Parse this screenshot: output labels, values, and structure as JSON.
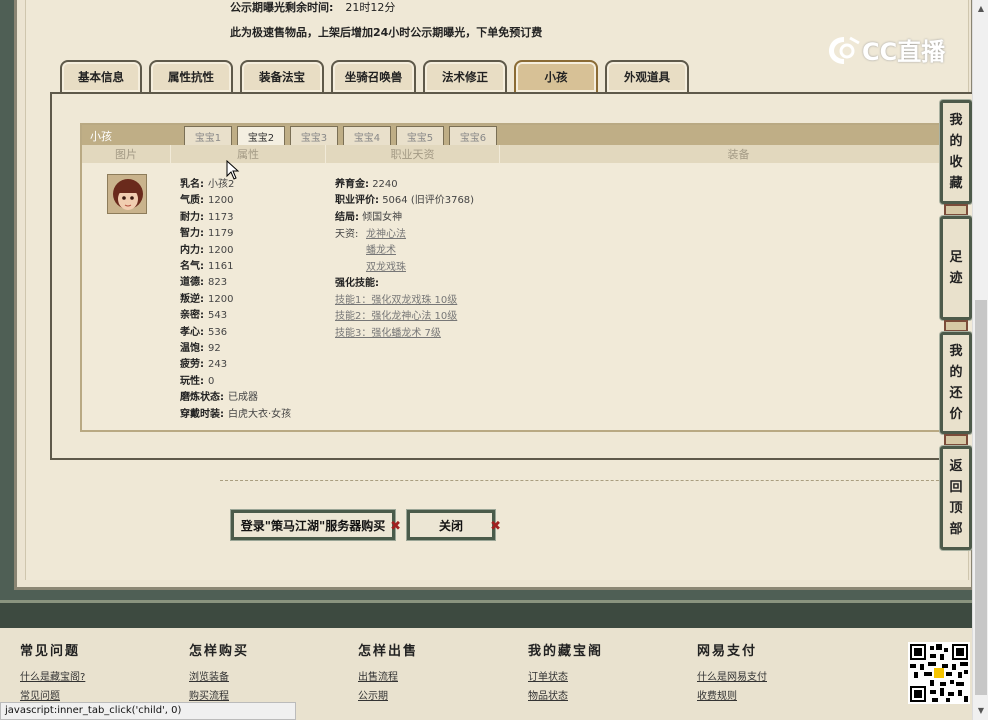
{
  "notice": {
    "line1_label": "公示期曝光剩余时间:",
    "line1_value": "21时12分",
    "line2": "此为极速售物品，上架后增加24小时公示期曝光，下单免预订费"
  },
  "main_tabs": [
    "基本信息",
    "属性抗性",
    "装备法宝",
    "坐骑召唤兽",
    "法术修正",
    "小孩",
    "外观道具"
  ],
  "logo": "CC直播",
  "child_section": {
    "title": "小孩",
    "baby_tabs": [
      "宝宝1",
      "宝宝2",
      "宝宝3",
      "宝宝4",
      "宝宝5",
      "宝宝6"
    ],
    "columns": [
      "图片",
      "属性",
      "职业天资",
      "装备"
    ],
    "attributes": [
      {
        "k": "乳名:",
        "v": "小孩2"
      },
      {
        "k": "气质:",
        "v": "1200"
      },
      {
        "k": "耐力:",
        "v": "1173"
      },
      {
        "k": "智力:",
        "v": "1179"
      },
      {
        "k": "内力:",
        "v": "1200"
      },
      {
        "k": "名气:",
        "v": "1161"
      },
      {
        "k": "道德:",
        "v": "823"
      },
      {
        "k": "叛逆:",
        "v": "1200"
      },
      {
        "k": "亲密:",
        "v": "543"
      },
      {
        "k": "孝心:",
        "v": "536"
      },
      {
        "k": "温饱:",
        "v": "92"
      },
      {
        "k": "疲劳:",
        "v": "243"
      },
      {
        "k": "玩性:",
        "v": "0"
      },
      {
        "k": "磨炼状态:",
        "v": "已成器"
      },
      {
        "k": "穿戴时装:",
        "v": "白虎大衣·女孩"
      }
    ],
    "career": {
      "upbringing_k": "养育金:",
      "upbringing_v": "2240",
      "rating_k": "职业评价:",
      "rating_v": "5064 (旧评价3768)",
      "ending_k": "结局:",
      "ending_v": "倾国女神",
      "talent_k": "天资:",
      "talents": [
        "龙神心法",
        "蟠龙术",
        "双龙戏珠"
      ],
      "skills_k": "强化技能:",
      "skills": [
        "技能1：强化双龙戏珠 10级",
        "技能2：强化龙神心法 10级",
        "技能3：强化蟠龙术 7级"
      ]
    }
  },
  "buttons": {
    "login": "登录\"策马江湖\"服务器购买",
    "close": "关闭"
  },
  "side_buttons": [
    [
      "我",
      "的",
      "收",
      "藏"
    ],
    [
      "足",
      "迹"
    ],
    [
      "我",
      "的",
      "还",
      "价"
    ],
    [
      "返",
      "回",
      "顶",
      "部"
    ]
  ],
  "footer": {
    "columns": [
      {
        "title": "常见问题",
        "links": [
          "什么是藏宝阁?",
          "常见问题"
        ]
      },
      {
        "title": "怎样购买",
        "links": [
          "浏览装备",
          "购买流程"
        ]
      },
      {
        "title": "怎样出售",
        "links": [
          "出售流程",
          "公示期"
        ]
      },
      {
        "title": "我的藏宝阁",
        "links": [
          "订单状态",
          "物品状态"
        ]
      },
      {
        "title": "网易支付",
        "links": [
          "什么是网易支付",
          "收费规则"
        ]
      }
    ]
  },
  "status_bar": "javascript:inner_tab_click('child', 0)",
  "colors": {
    "frame": "#4f5f55",
    "paper": "#efe8d6",
    "header": "#bfae86",
    "accent_red": "#a02020"
  }
}
